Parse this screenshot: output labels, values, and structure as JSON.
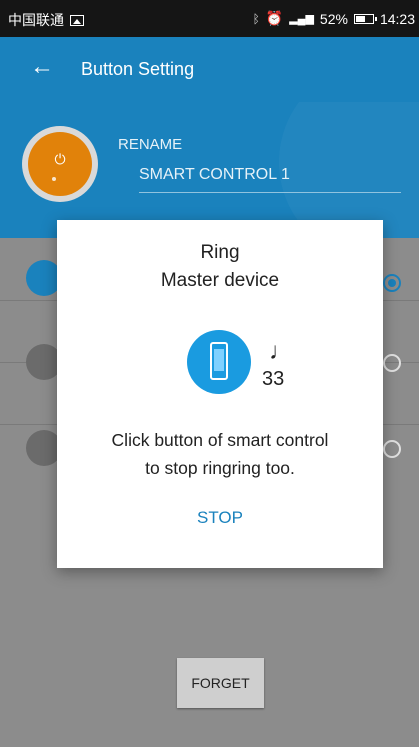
{
  "status_bar": {
    "carrier": "中国联通",
    "battery": "52%",
    "time": "14:23"
  },
  "app_bar": {
    "back_icon": "arrow-left-icon",
    "title": "Button Setting"
  },
  "header": {
    "rename_label": "RENAME",
    "device_name": "SMART CONTROL 1"
  },
  "list_rows": [
    {
      "icon": "bell-icon",
      "color": "#1a82bd",
      "selected": true
    },
    {
      "icon": "camera-icon",
      "color": "#6b6b6b",
      "selected": false
    },
    {
      "icon": "trash-icon",
      "color": "#6b6b6b",
      "selected": false
    }
  ],
  "footer": {
    "forget_label": "FORGET"
  },
  "dialog": {
    "title_line1": "Ring",
    "title_line2": "Master device",
    "icon": "phone-icon",
    "music_icon": "music-note-icon",
    "count": "33",
    "message_line1": "Click button of smart control",
    "message_line2": "to stop ringring too.",
    "stop_label": "STOP"
  },
  "colors": {
    "primary": "#1a82bd",
    "accent_orange": "#e1820a",
    "dialog_icon": "#1a9be0"
  }
}
